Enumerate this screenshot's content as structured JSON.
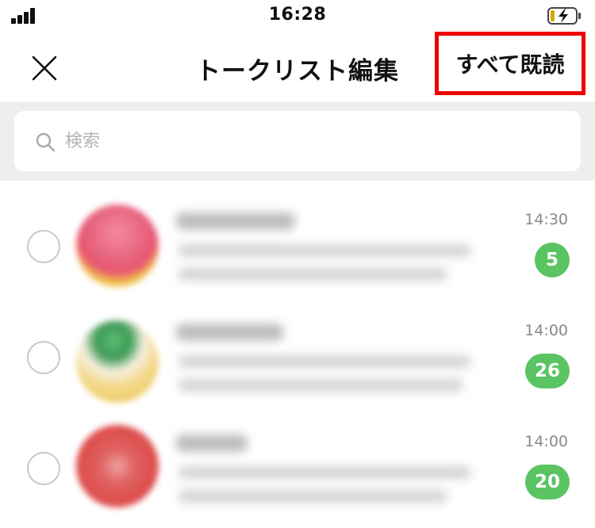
{
  "status_bar": {
    "time": "16:28"
  },
  "header": {
    "title": "トークリスト編集",
    "mark_all_read": "すべて既読"
  },
  "search": {
    "placeholder": "検索"
  },
  "chats": [
    {
      "time": "14:30",
      "unread": "5"
    },
    {
      "time": "14:00",
      "unread": "26"
    },
    {
      "time": "14:00",
      "unread": "20"
    }
  ],
  "colors": {
    "accent_green": "#5ac463",
    "highlight_red": "#ee0000"
  }
}
